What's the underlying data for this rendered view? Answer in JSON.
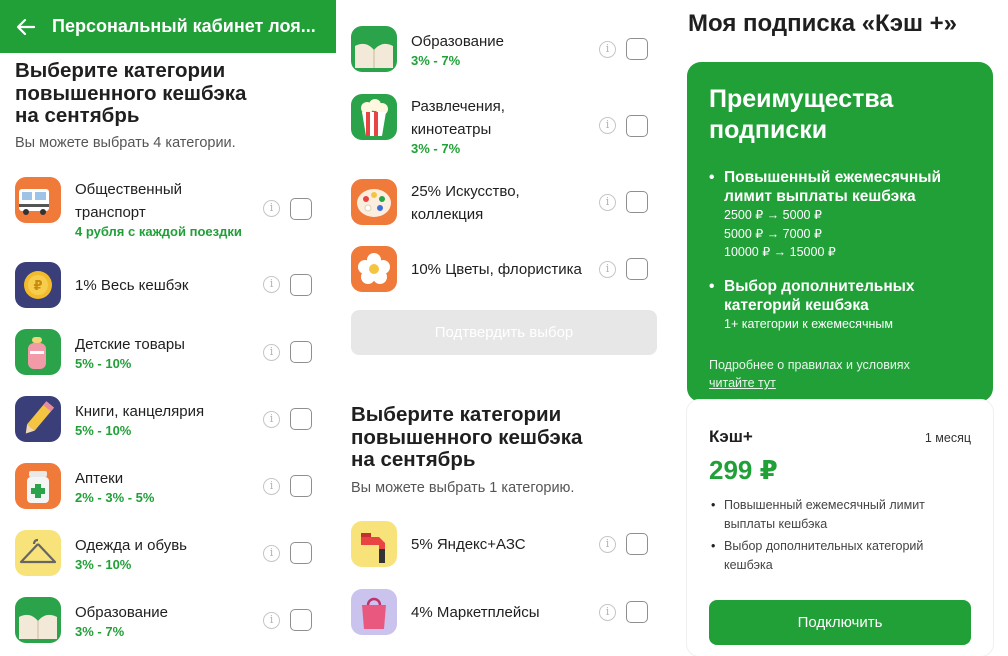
{
  "panel1": {
    "header_title": "Персональный кабинет лоя...",
    "heading_lines": [
      "Выберите категории",
      "повышенного кешбэка",
      "на сентябрь"
    ],
    "subtitle": "Вы можете выбрать 4 категории.",
    "categories": [
      {
        "name": [
          "Общественный",
          "транспорт"
        ],
        "sub": "4 рубля с каждой поездки",
        "icon": "bus-icon"
      },
      {
        "name": [
          "1% Весь кешбэк"
        ],
        "sub": "",
        "icon": "coin-icon"
      },
      {
        "name": [
          "Детские товары"
        ],
        "sub": "5% - 10%",
        "icon": "baby-bottle-icon"
      },
      {
        "name": [
          "Книги, канцелярия"
        ],
        "sub": "5% - 10%",
        "icon": "pencil-icon"
      },
      {
        "name": [
          "Аптеки"
        ],
        "sub": "2% - 3% - 5%",
        "icon": "pill-bottle-icon"
      },
      {
        "name": [
          "Одежда и обувь"
        ],
        "sub": "3% - 10%",
        "icon": "hanger-icon"
      },
      {
        "name": [
          "Образование"
        ],
        "sub": "3% - 7%",
        "icon": "book-icon"
      }
    ]
  },
  "panel2": {
    "categories": [
      {
        "name": [
          "Образование"
        ],
        "sub": "3% - 7%",
        "icon": "book-icon"
      },
      {
        "name": [
          "Развлечения,",
          "кинотеатры"
        ],
        "sub": "3% - 7%",
        "icon": "popcorn-icon"
      },
      {
        "name": [
          "25% Искусство,",
          "коллекция"
        ],
        "sub": "",
        "icon": "palette-icon"
      },
      {
        "name": [
          "10% Цветы, флористика"
        ],
        "sub": "",
        "icon": "flower-icon"
      }
    ],
    "confirm_button": "Подтвердить выбор",
    "heading_lines": [
      "Выберите категории",
      "повышенного кешбэка",
      "на сентябрь"
    ],
    "subtitle": "Вы можете выбрать 1 категорию.",
    "categories2": [
      {
        "name": [
          "5% Яндекс+АЗС"
        ],
        "sub": "",
        "icon": "fuel-nozzle-icon"
      },
      {
        "name": [
          "4% Маркетплейсы"
        ],
        "sub": "",
        "icon": "shopping-bag-icon"
      }
    ]
  },
  "panel3": {
    "title": "Моя подписка «Кэш +»",
    "benefits_title_lines": [
      "Преимущества",
      "подписки"
    ],
    "benefit1_title_lines": [
      "Повышенный ежемесячный",
      "лимит выплаты кешбэка"
    ],
    "benefit1_lines": [
      "2500 ₽ → 5000 ₽",
      "5000 ₽ → 7000 ₽",
      "10000 ₽ → 15000 ₽"
    ],
    "benefit2_title_lines": [
      "Выбор дополнительных",
      "категорий кешбэка"
    ],
    "benefit2_lines": [
      "1+ категории к ежемесячным"
    ],
    "more_text": "Подробнее о правилах и условиях",
    "more_link": "читайте тут",
    "plan_name": "Кэш+",
    "plan_period": "1 месяц",
    "plan_price": "299 ₽",
    "plan_features": [
      "Повышенный ежемесячный лимит выплаты кешбэка",
      "Выбор дополнительных категорий кешбэка"
    ],
    "subscribe_button": "Подключить"
  },
  "colors": {
    "brand_green": "#21a038",
    "disabled_button": "#e7e7e7"
  }
}
